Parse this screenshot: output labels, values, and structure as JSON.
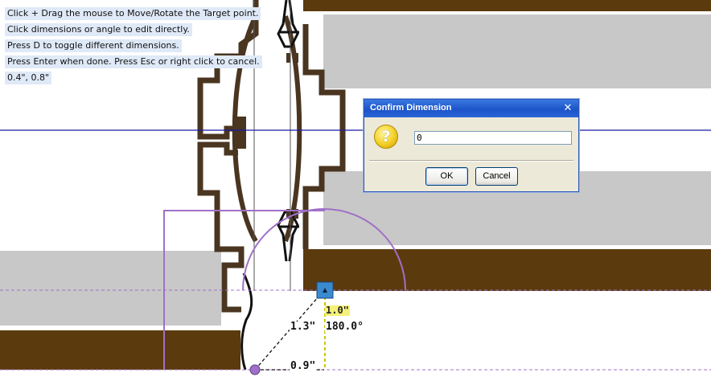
{
  "hints": [
    "Click + Drag the mouse to Move/Rotate the Target point.",
    "Click dimensions or angle to edit directly.",
    "Press D to toggle different dimensions.",
    "Press Enter when done. Press Esc or right click to cancel.",
    "0.4\", 0.8\""
  ],
  "dimensions": {
    "diagonal": "1.3\"",
    "horizontal": "0.9\"",
    "angle": "180.0°",
    "vertical_highlight": "1.0\""
  },
  "dialog": {
    "title": "Confirm Dimension",
    "input_value": "0",
    "ok_label": "OK",
    "cancel_label": "Cancel",
    "close_glyph": "✕",
    "icon_glyph": "?"
  },
  "colors": {
    "wood": "#5b3a0d",
    "part_outline": "#4a3520",
    "panel_gray": "#c8c8c8",
    "guide_blue": "#1a1aa8",
    "arc_purple": "#a070c8",
    "target_blue": "#3a8ad0"
  }
}
